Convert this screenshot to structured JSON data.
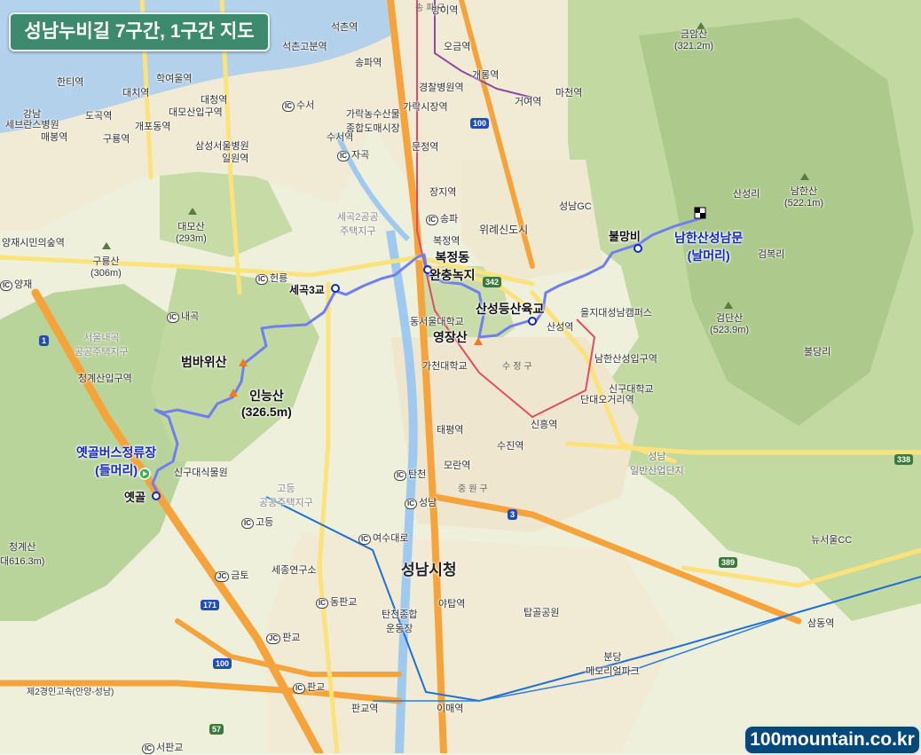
{
  "title": "성남누비길 7구간, 1구간 지도",
  "brand": "100mountain.co.kr",
  "route_points": {
    "start": {
      "name": "옛골버스정류장",
      "note": "(들머리)"
    },
    "end": {
      "name": "남한산성남문",
      "note": "(날머리)"
    },
    "oetgol": "옛골",
    "beombawi": "범바위산",
    "inneung": "인능산",
    "inneung_height": "(326.5m)",
    "segok3": "세곡3교",
    "bokjeong1": "복정동",
    "bokjeong2": "완충녹지",
    "sanseong_bridge": "산성등산육교",
    "yeongjang": "영장산",
    "bulmangbi": "불망비"
  },
  "peaks": [
    {
      "name": "금암산",
      "height": "(321.2m)"
    },
    {
      "name": "남한산",
      "height": "(522.1m)"
    },
    {
      "name": "검단산",
      "height": "(523.9m)"
    },
    {
      "name": "대모산",
      "height": "(293m)"
    },
    {
      "name": "구룡산",
      "height": "(306m)"
    },
    {
      "name": "청계산",
      "height": "대616.3m)"
    }
  ],
  "city_hall": "성남시청",
  "stations": {
    "seokchon": "석촌역",
    "seokchongobun": "석촌고분역",
    "songpa": "송파역",
    "ogeum": "오금역",
    "gaerong": "개롱역",
    "geoyeo": "거여역",
    "macheon": "마천역",
    "gyeongchal": "경찰병원역",
    "garak": "가락시장역",
    "munjeong": "문정역",
    "jangji": "장지역",
    "bokjeong": "복정역",
    "banghi": "방이역",
    "hanti": "한티역",
    "daechi": "대치역",
    "hakyeoul": "학여울역",
    "daecheong": "대청역",
    "irwon": "일원역",
    "dogok": "도곡역",
    "maebong": "매봉역",
    "guryong": "구룡역",
    "gaepo": "개포동역",
    "daemo": "대모산입구역",
    "suseo": "수서역",
    "sanseong": "산성역",
    "namhansanseong": "남한산성입구역",
    "dandaeogeori": "단대오거리역",
    "sinheung": "신흥역",
    "sujin": "수진역",
    "taepyeong": "태평역",
    "moran": "모란역",
    "samdong": "삼동역",
    "imae": "이매역",
    "pangyo": "판교역",
    "cheonggye": "청계산입구역",
    "samsung_hosp": "삼성서울병원",
    "gangnam_sev": "세브란스병원"
  },
  "places": {
    "gangnam": "강남",
    "garak_market": "가락농수산물\n종합도매시장",
    "wirye": "위례신도시",
    "seongnam_gc": "성남GC",
    "sanseongri": "산성리",
    "nammhan_bongni": "검복리",
    "bulgokri": "불당리",
    "eulji": "을지대성남캠퍼스",
    "donseoul": "동서울대학교",
    "gachon": "가천대학교",
    "singu": "신구대학교",
    "singu_garden": "신구대식물원",
    "sujeong": "수정구",
    "jungwon": "중원구",
    "seongnam_ind": "성남\n일반산업단지",
    "newseoul_cc": "뉴서울CC",
    "tapgol": "탑골공원",
    "bundang_memorial": "분당\n메모리얼파크",
    "tancheon": "탄천종합\n운동장",
    "seongnam_gi": "세종연구소",
    "segok_apt": "세곡2공공\n주택지구",
    "godeung_apt": "고등\n공공주택지구",
    "seoul_naegok": "서울내곡\n공공주택지구",
    "yangjae": "양재시민의숲역",
    "yadap": "야탑역",
    "highway2": "제2경인고속(안양-성남)",
    "songpa_gu": "송파구",
    "sujeong_dist": "수정구",
    "jungwon_dist": "중원구"
  },
  "interchanges": {
    "heolleung": "헌릉",
    "naegok": "내곡",
    "yangjae": "양재",
    "geumto": "금토",
    "pangyo_jc": "판교",
    "dongpangyo": "동판교",
    "pangyo_ic": "판교",
    "seopangyo": "서판교",
    "suseo": "수서",
    "jagok": "자곡",
    "songpa": "송파",
    "yeosu": "여수대로",
    "godeung": "고등",
    "tancheon": "탄천",
    "seongnam": "성남"
  },
  "road_shields": [
    "100",
    "1",
    "171",
    "100",
    "3",
    "338",
    "389",
    "342",
    "57"
  ],
  "colors": {
    "route": "#6f7ff2",
    "expressway": "#f5a33a",
    "main_road": "#fbe27a",
    "river": "#9fc9ee",
    "forest": "#b7d39a",
    "urban": "#f3ecd9",
    "title_bg": "#3d8a6e",
    "brand_bg": "#06487a"
  }
}
